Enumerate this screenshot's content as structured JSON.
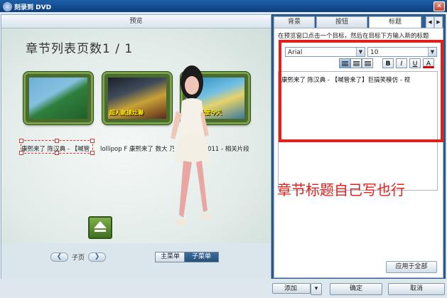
{
  "window": {
    "title": "刻录到 DVD",
    "close_glyph": "✕"
  },
  "preview": {
    "header": "预览",
    "chapter_title": "章节列表页数1 / 1",
    "thumbnails": [
      {
        "caption": ""
      },
      {
        "caption": "超人氣搶灶聯"
      },
      {
        "caption": "你為什麼今天"
      }
    ],
    "labels": [
      "康熙来了 陈汉典 - 【喊管",
      "lollipop F 康熙来了 数大 乃",
      "康熙来了 2011 - 相关片段"
    ]
  },
  "nav": {
    "prev_glyph": "❮",
    "next_glyph": "❯",
    "page_label": "子页",
    "main_menu": "主菜单",
    "sub_menu": "子菜单"
  },
  "right_panel": {
    "tabs": [
      "背景",
      "按钮",
      "标题"
    ],
    "active_tab": "标题",
    "hint": "在预览窗口点击一个目标，然后在目标下方输入新的标题",
    "font_name": "Arial",
    "font_size": "10",
    "format_buttons": [
      "B",
      "I",
      "U",
      "A"
    ],
    "title_text": "康熙来了 陈汉典 - 【喊管来了】巨搞笑模仿 - 视",
    "apply_all": "应用于全部"
  },
  "annotation": {
    "text": "章节标题自己写也行",
    "color": "#e2201b"
  },
  "bottom": {
    "add": "添加",
    "ok": "确定",
    "cancel": "取消"
  }
}
